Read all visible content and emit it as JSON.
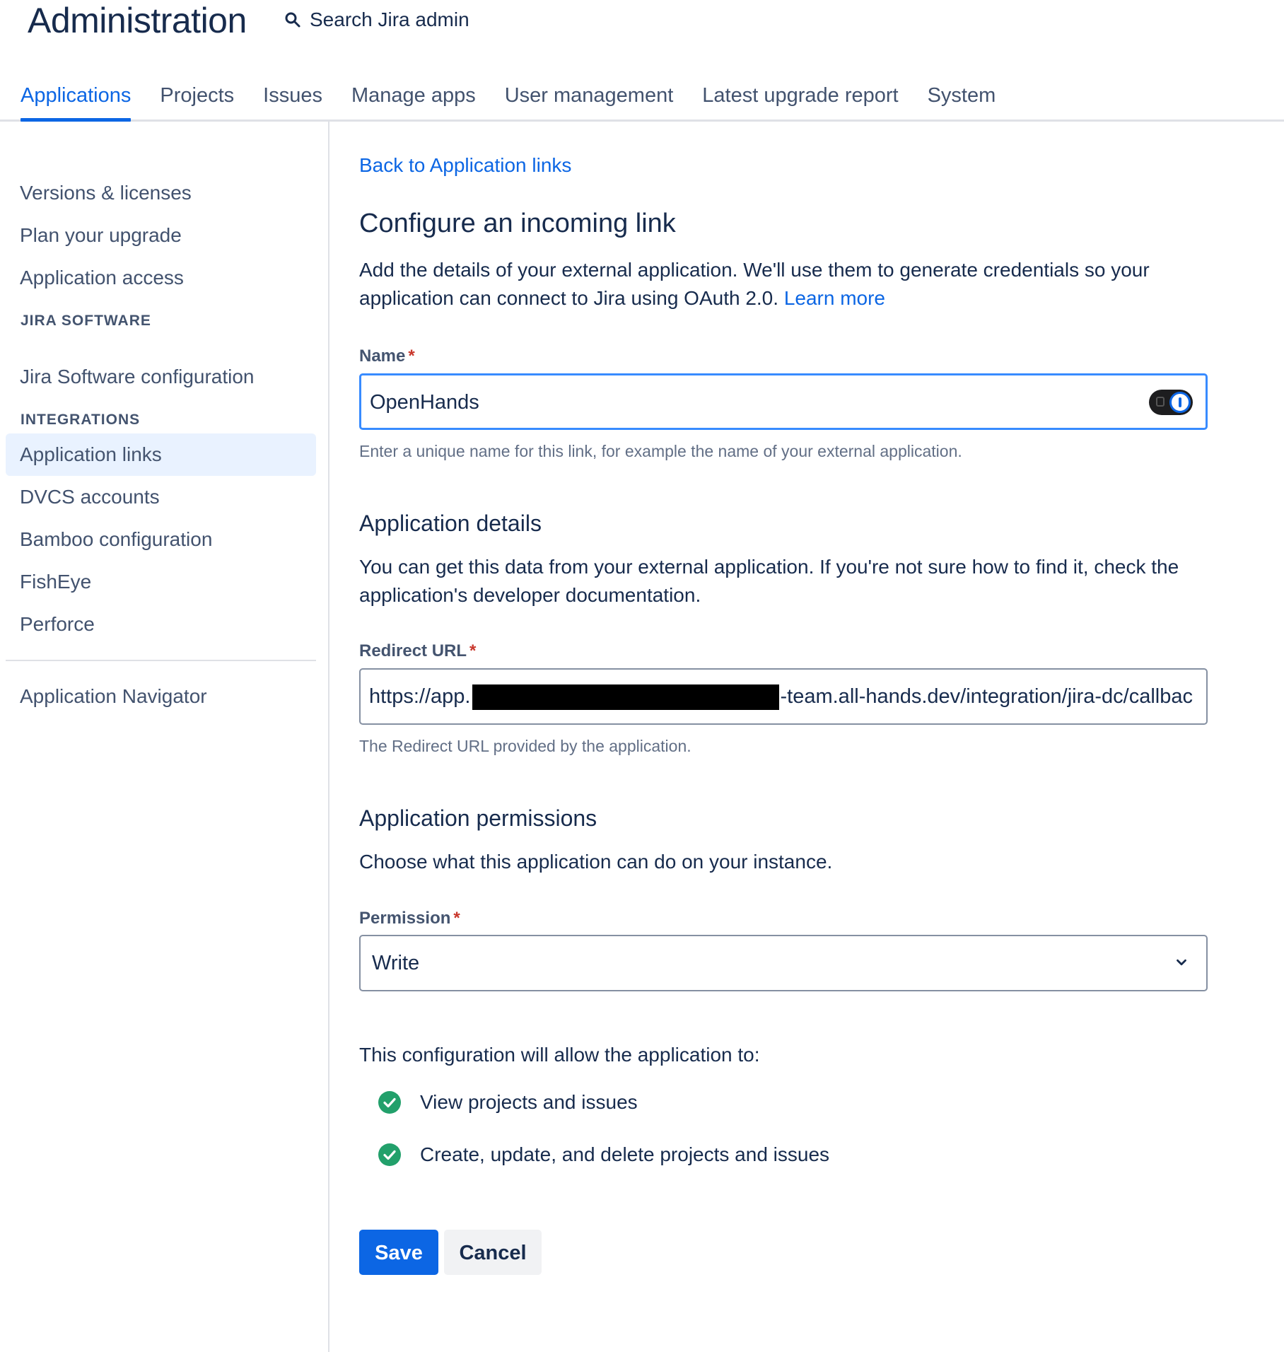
{
  "header": {
    "title": "Administration",
    "search_label": "Search Jira admin",
    "tabs": [
      {
        "label": "Applications",
        "active": true
      },
      {
        "label": "Projects"
      },
      {
        "label": "Issues"
      },
      {
        "label": "Manage apps"
      },
      {
        "label": "User management"
      },
      {
        "label": "Latest upgrade report"
      },
      {
        "label": "System"
      }
    ]
  },
  "sidebar": {
    "top_items": [
      "Versions & licenses",
      "Plan your upgrade",
      "Application access"
    ],
    "jira_software_heading": "JIRA SOFTWARE",
    "jira_software_items": [
      "Jira Software configuration"
    ],
    "integrations_heading": "INTEGRATIONS",
    "integrations_items": [
      "Application links",
      "DVCS accounts",
      "Bamboo configuration",
      "FishEye",
      "Perforce"
    ],
    "bottom_items": [
      "Application Navigator"
    ]
  },
  "main": {
    "back_link": "Back to Application links",
    "heading": "Configure an incoming link",
    "intro": "Add the details of your external application. We'll use them to generate credentials so your application can connect to Jira using OAuth 2.0.",
    "learn_more": "Learn more",
    "name_field": {
      "label": "Name",
      "required": "*",
      "value": "OpenHands",
      "helper": "Enter a unique name for this link, for example the name of your external application."
    },
    "details_section": {
      "heading": "Application details",
      "text": "You can get this data from your external application. If you're not sure how to find it, check the application's developer documentation."
    },
    "redirect_field": {
      "label": "Redirect URL",
      "required": "*",
      "value_prefix": "https://app.",
      "value_suffix": "-team.all-hands.dev/integration/jira-dc/callbac",
      "helper": "The Redirect URL provided by the application."
    },
    "permissions_section": {
      "heading": "Application permissions",
      "text": "Choose what this application can do on your instance."
    },
    "permission_field": {
      "label": "Permission",
      "required": "*",
      "value": "Write"
    },
    "allow_text": "This configuration will allow the application to:",
    "allow_items": [
      "View projects and issues",
      "Create, update, and delete projects and issues"
    ],
    "save_label": "Save",
    "cancel_label": "Cancel"
  },
  "colors": {
    "accent": "#0c66e4",
    "success": "#22a06b",
    "text": "#172b4d",
    "required": "#c9372c"
  }
}
